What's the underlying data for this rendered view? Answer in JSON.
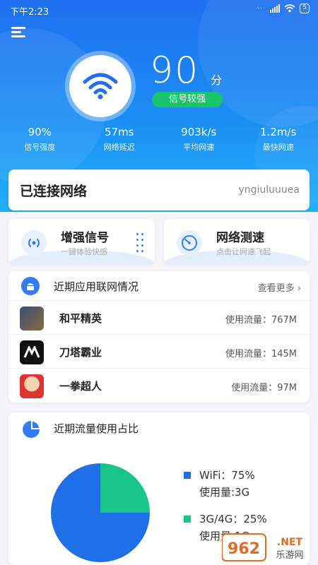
{
  "status_bar": {
    "time": "下午2:23",
    "battery": "5"
  },
  "hero": {
    "score": "90",
    "score_unit": "分",
    "signal_status": "信号较强",
    "stats": [
      {
        "value": "90%",
        "label": "信号强度"
      },
      {
        "value": "57ms",
        "label": "网络延迟"
      },
      {
        "value": "903k/s",
        "label": "平均网速"
      },
      {
        "value": "1.2m/s",
        "label": "最快网速"
      }
    ]
  },
  "connection": {
    "title": "已连接网络",
    "ssid": "yngiuluuuea"
  },
  "actions": {
    "boost": {
      "title": "增强信号",
      "subtitle": "一键体验快感"
    },
    "speedtest": {
      "title": "网络测速",
      "subtitle": "点击让网速飞起"
    }
  },
  "apps_section": {
    "title": "近期应用联网情况",
    "more": "查看更多",
    "apps": [
      {
        "name": "和平精英",
        "usage": "使用流量：767M",
        "icon": "game-icon"
      },
      {
        "name": "刀塔霸业",
        "usage": "使用流量：145M",
        "icon": "game-icon"
      },
      {
        "name": "一拳超人",
        "usage": "使用流量：97M",
        "icon": "game-icon"
      }
    ]
  },
  "traffic_section": {
    "title": "近期流量使用占比",
    "legend": [
      {
        "name": "WiFi：75%",
        "used": "使用量:3G",
        "color": "#1f6fe8",
        "percent": 75
      },
      {
        "name": "3G/4G：25%",
        "used": "使用量:1G",
        "color": "#19c48a",
        "percent": 25
      }
    ]
  },
  "watermark": {
    "logo": "962.NET",
    "site": "乐游网"
  },
  "colors": {
    "primary": "#1f6ff0",
    "green": "#19c46a",
    "accent": "#1fb0f7"
  }
}
